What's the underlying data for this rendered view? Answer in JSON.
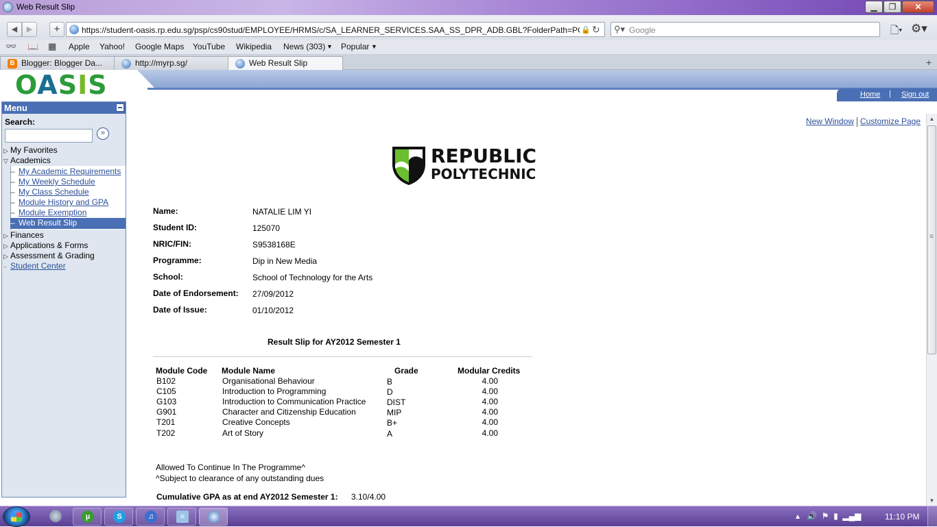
{
  "window": {
    "title": "Web Result Slip",
    "minimize": "▁",
    "maximize": "❐",
    "close": "✕"
  },
  "navigation": {
    "back": "◀",
    "forward": "▶",
    "new": "+",
    "url": "https://student-oasis.rp.edu.sg/psp/cs90stud/EMPLOYEE/HRMS/c/SA_LEARNER_SERVICES.SAA_SS_DPR_ADB.GBL?FolderPath=PORTAL_R(",
    "lock": "🔒",
    "reload": "↻",
    "search_placeholder": "Google",
    "search_icon": "magnifier-icon",
    "page_menu": "page-menu-icon",
    "settings_menu": "gear-icon"
  },
  "bookmarks": {
    "items": [
      "Apple",
      "Yahoo!",
      "Google Maps",
      "YouTube",
      "Wikipedia",
      "News (303)",
      "Popular"
    ],
    "icons": [
      "reading-list-icon",
      "bookmarks-book-icon",
      "top-sites-grid-icon"
    ]
  },
  "tabs": [
    {
      "label": "Blogger: Blogger Da...",
      "icon": "blogger-icon",
      "active": false
    },
    {
      "label": "http://myrp.sg/",
      "icon": "globe-icon",
      "active": false
    },
    {
      "label": "Web Result Slip",
      "icon": "globe-icon",
      "active": true
    }
  ],
  "oasis": {
    "logo": "OASIS",
    "links": {
      "home": "Home",
      "signout": "Sign out"
    }
  },
  "menu": {
    "title": "Menu",
    "search_label": "Search:",
    "search_go": "»",
    "items": [
      {
        "label": "My Favorites",
        "expanded": false
      },
      {
        "label": "Academics",
        "expanded": true
      },
      {
        "label": "Finances",
        "expanded": false
      },
      {
        "label": "Applications & Forms",
        "expanded": false
      },
      {
        "label": "Assessment & Grading",
        "expanded": false
      }
    ],
    "academics_sub": [
      "My Academic Requirements",
      "My Weekly Schedule",
      "My Class Schedule",
      "Module History and GPA",
      "Module Exemption",
      "Web Result Slip"
    ],
    "selected": "Web Result Slip",
    "student_center": "Student Center"
  },
  "content": {
    "new_window": "New Window",
    "customize_page": "Customize Page",
    "logo_line1": "REPUBLIC",
    "logo_line2": "POLYTECHNIC",
    "info": [
      {
        "label": "Name:",
        "value": "NATALIE LIM YI"
      },
      {
        "label": "Student ID:",
        "value": "125070"
      },
      {
        "label": "NRIC/FIN:",
        "value": "S9538168E"
      },
      {
        "label": "Programme:",
        "value": "Dip in New Media"
      },
      {
        "label": "School:",
        "value": "School of Technology for the Arts"
      },
      {
        "label": "Date of Endorsement:",
        "value": "27/09/2012"
      },
      {
        "label": "Date of Issue:",
        "value": "01/10/2012"
      }
    ],
    "slip_title": "Result Slip for  AY2012 Semester 1",
    "columns": [
      "Module Code",
      "Module Name",
      "Grade",
      "Modular Credits"
    ],
    "modules": [
      {
        "code": "B102",
        "name": "Organisational Behaviour",
        "grade": "B",
        "credits": "4.00"
      },
      {
        "code": "C105",
        "name": "Introduction to Programming",
        "grade": "D",
        "credits": "4.00"
      },
      {
        "code": "G103",
        "name": "Introduction to Communication Practice",
        "grade": "DIST",
        "credits": "4.00"
      },
      {
        "code": "G901",
        "name": "Character and Citizenship Education",
        "grade": "MIP",
        "credits": "4.00"
      },
      {
        "code": "T201",
        "name": "Creative Concepts",
        "grade": "B+",
        "credits": "4.00"
      },
      {
        "code": "T202",
        "name": "Art of Story",
        "grade": "A",
        "credits": "4.00"
      }
    ],
    "note_continue": "Allowed To Continue In The Programme^",
    "note_clearance": "^Subject to clearance of any outstanding dues",
    "gpa_label": "Cumulative GPA as at end AY2012 Semester 1:",
    "gpa_value": "3.10/4.00"
  },
  "taskbar": {
    "pinned": [
      "chrome-icon",
      "utorrent-icon",
      "skype-icon",
      "itunes-icon",
      "notepad-icon",
      "safari-icon"
    ],
    "clock": "11:10 PM",
    "tray_icons": [
      "show-hidden-icon",
      "volume-icon",
      "network-flag-icon",
      "power-icon",
      "signal-icon"
    ]
  },
  "colors": {
    "menu_header": "#4a6fb5",
    "link": "#2b4f99",
    "oasis_green": "#2c9b3a",
    "taskbar": "#5b3f94"
  }
}
